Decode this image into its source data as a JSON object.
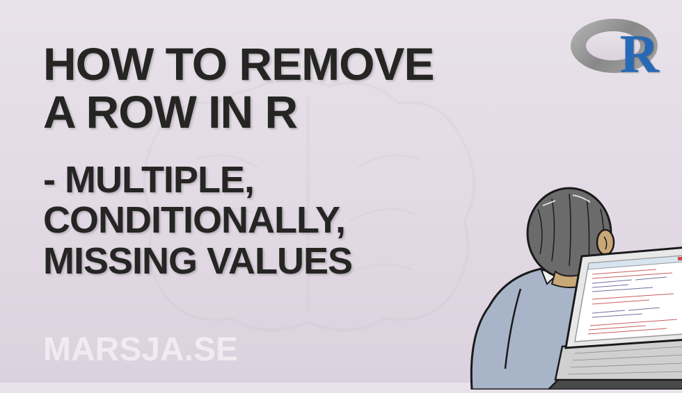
{
  "title_line1": "HOW TO REMOVE",
  "title_line2": "A ROW IN R",
  "subtitle_line1": "- MULTIPLE,",
  "subtitle_line2": "CONDITIONALLY,",
  "subtitle_line3": "MISSING VALUES",
  "site_name": "MARSJA.SE",
  "logo_letter": "R"
}
